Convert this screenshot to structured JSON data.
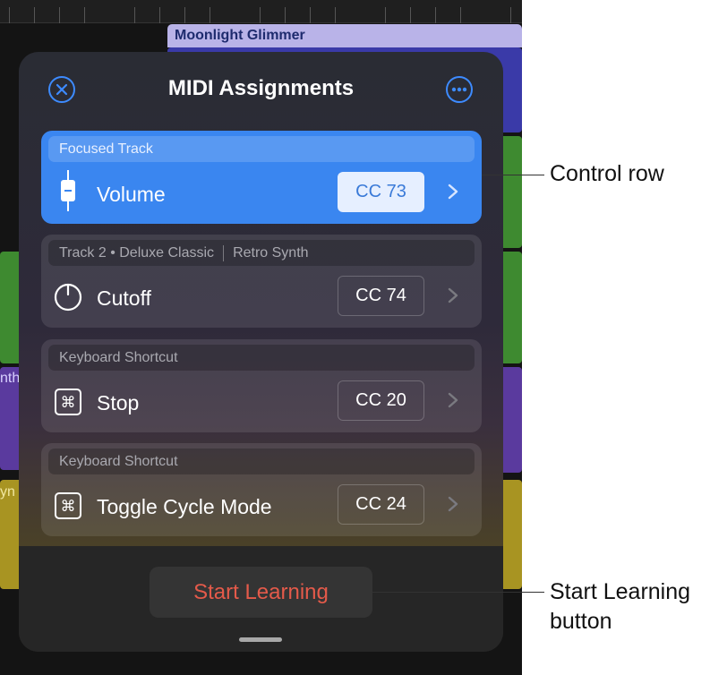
{
  "background": {
    "region_title": "Moonlight Glimmer",
    "stub_left_1": "nth",
    "stub_left_2": "yn"
  },
  "panel": {
    "title": "MIDI Assignments",
    "close_icon": "close-circle-icon",
    "more_icon": "ellipsis-circle-icon",
    "accent_color": "#3d8bff",
    "rows": [
      {
        "header": "Focused Track",
        "header_extra": "",
        "label": "Volume",
        "cc": "CC 73",
        "icon": "fader-icon",
        "focused": true
      },
      {
        "header": "Track 2 • Deluxe Classic",
        "header_extra": "Retro Synth",
        "label": "Cutoff",
        "cc": "CC 74",
        "icon": "knob-icon",
        "focused": false
      },
      {
        "header": "Keyboard Shortcut",
        "header_extra": "",
        "label": "Stop",
        "cc": "CC 20",
        "icon": "command-key-icon",
        "focused": false
      },
      {
        "header": "Keyboard Shortcut",
        "header_extra": "",
        "label": "Toggle Cycle Mode",
        "cc": "CC 24",
        "icon": "command-key-icon",
        "focused": false
      }
    ],
    "start_button": "Start Learning",
    "start_color": "#e45a4a"
  },
  "callouts": {
    "control_row": "Control row",
    "start_line1": "Start Learning",
    "start_line2": "button"
  }
}
